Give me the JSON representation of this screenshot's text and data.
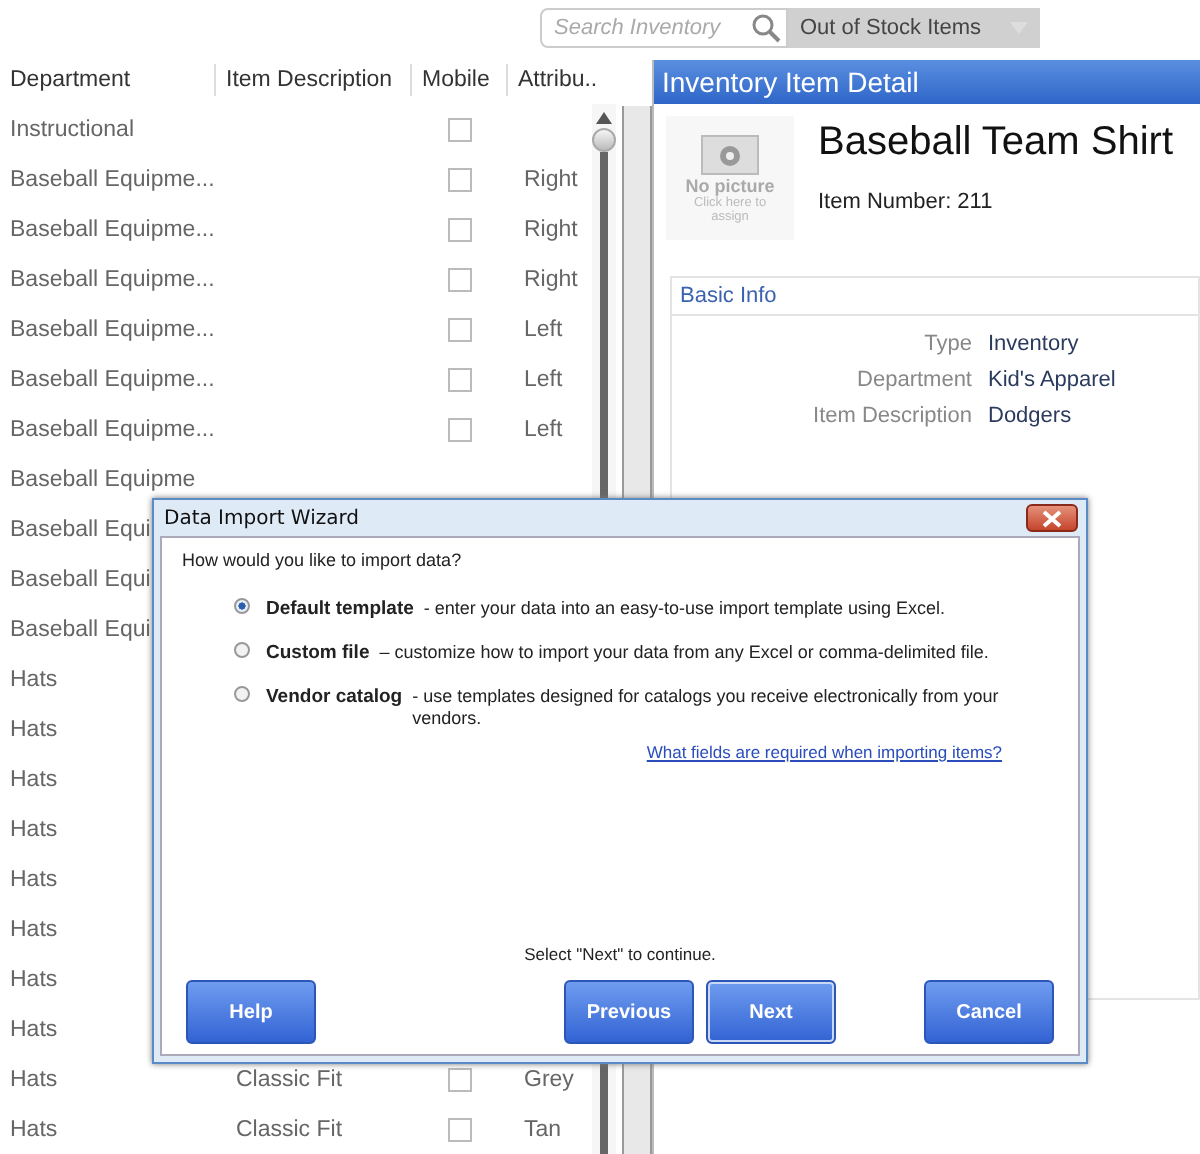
{
  "toolbar": {
    "search": {
      "placeholder": "Search Inventory"
    },
    "filter": {
      "value": "Out of Stock Items"
    }
  },
  "table": {
    "columns": [
      "Department",
      "Item Description",
      "Mobile",
      "Attribu.."
    ],
    "rows": [
      {
        "department": "Instructional",
        "mobile": false
      },
      {
        "department": "Baseball Equipme...",
        "mobile": false,
        "attribute": "Right"
      },
      {
        "department": "Baseball Equipme...",
        "mobile": false,
        "attribute": "Right"
      },
      {
        "department": "Baseball Equipme...",
        "mobile": false,
        "attribute": "Right"
      },
      {
        "department": "Baseball Equipme...",
        "mobile": false,
        "attribute": "Left"
      },
      {
        "department": "Baseball Equipme...",
        "mobile": false,
        "attribute": "Left"
      },
      {
        "department": "Baseball Equipme...",
        "mobile": false,
        "attribute": "Left"
      },
      {
        "department": "Baseball Equipme"
      },
      {
        "department": "Baseball Equi"
      },
      {
        "department": "Baseball Equi"
      },
      {
        "department": "Baseball Equi"
      },
      {
        "department": "Hats"
      },
      {
        "department": "Hats"
      },
      {
        "department": "Hats"
      },
      {
        "department": "Hats"
      },
      {
        "department": "Hats"
      },
      {
        "department": "Hats"
      },
      {
        "department": "Hats"
      },
      {
        "department": "Hats"
      },
      {
        "department": "Hats",
        "description": "Classic Fit",
        "mobile": false,
        "attribute": "Grey"
      },
      {
        "department": "Hats",
        "description": "Classic Fit",
        "mobile": false,
        "attribute": "Tan"
      }
    ]
  },
  "detail": {
    "title": "Inventory Item Detail",
    "picture": {
      "label": "No picture",
      "hint": "Click here to assign"
    },
    "name": "Baseball Team Shirt",
    "item_number": "Item Number: 211",
    "section": "Basic Info",
    "fields": [
      {
        "label": "Type",
        "value": "Inventory"
      },
      {
        "label": "Department",
        "value": "Kid's Apparel"
      },
      {
        "label": "Item Description",
        "value": "Dodgers"
      }
    ]
  },
  "dialog": {
    "title": "Data Import Wizard",
    "question": "How would you like to import data?",
    "options": [
      {
        "name": "Default template",
        "description": "- enter your data into an easy-to-use import template using Excel.",
        "selected": true
      },
      {
        "name": "Custom file",
        "description": "– customize how to import your data from any Excel or comma-delimited file.",
        "selected": false
      },
      {
        "name": "Vendor catalog",
        "description": "- use templates designed for catalogs you receive electronically from your vendors.",
        "selected": false
      }
    ],
    "link": "What fields are required when importing items?",
    "hint": "Select \"Next\" to continue.",
    "buttons": [
      {
        "label": "Help",
        "kind": "left"
      },
      {
        "label": "Previous",
        "kind": "nav"
      },
      {
        "label": "Next",
        "kind": "nav"
      },
      {
        "label": "Cancel",
        "kind": "right"
      }
    ]
  }
}
